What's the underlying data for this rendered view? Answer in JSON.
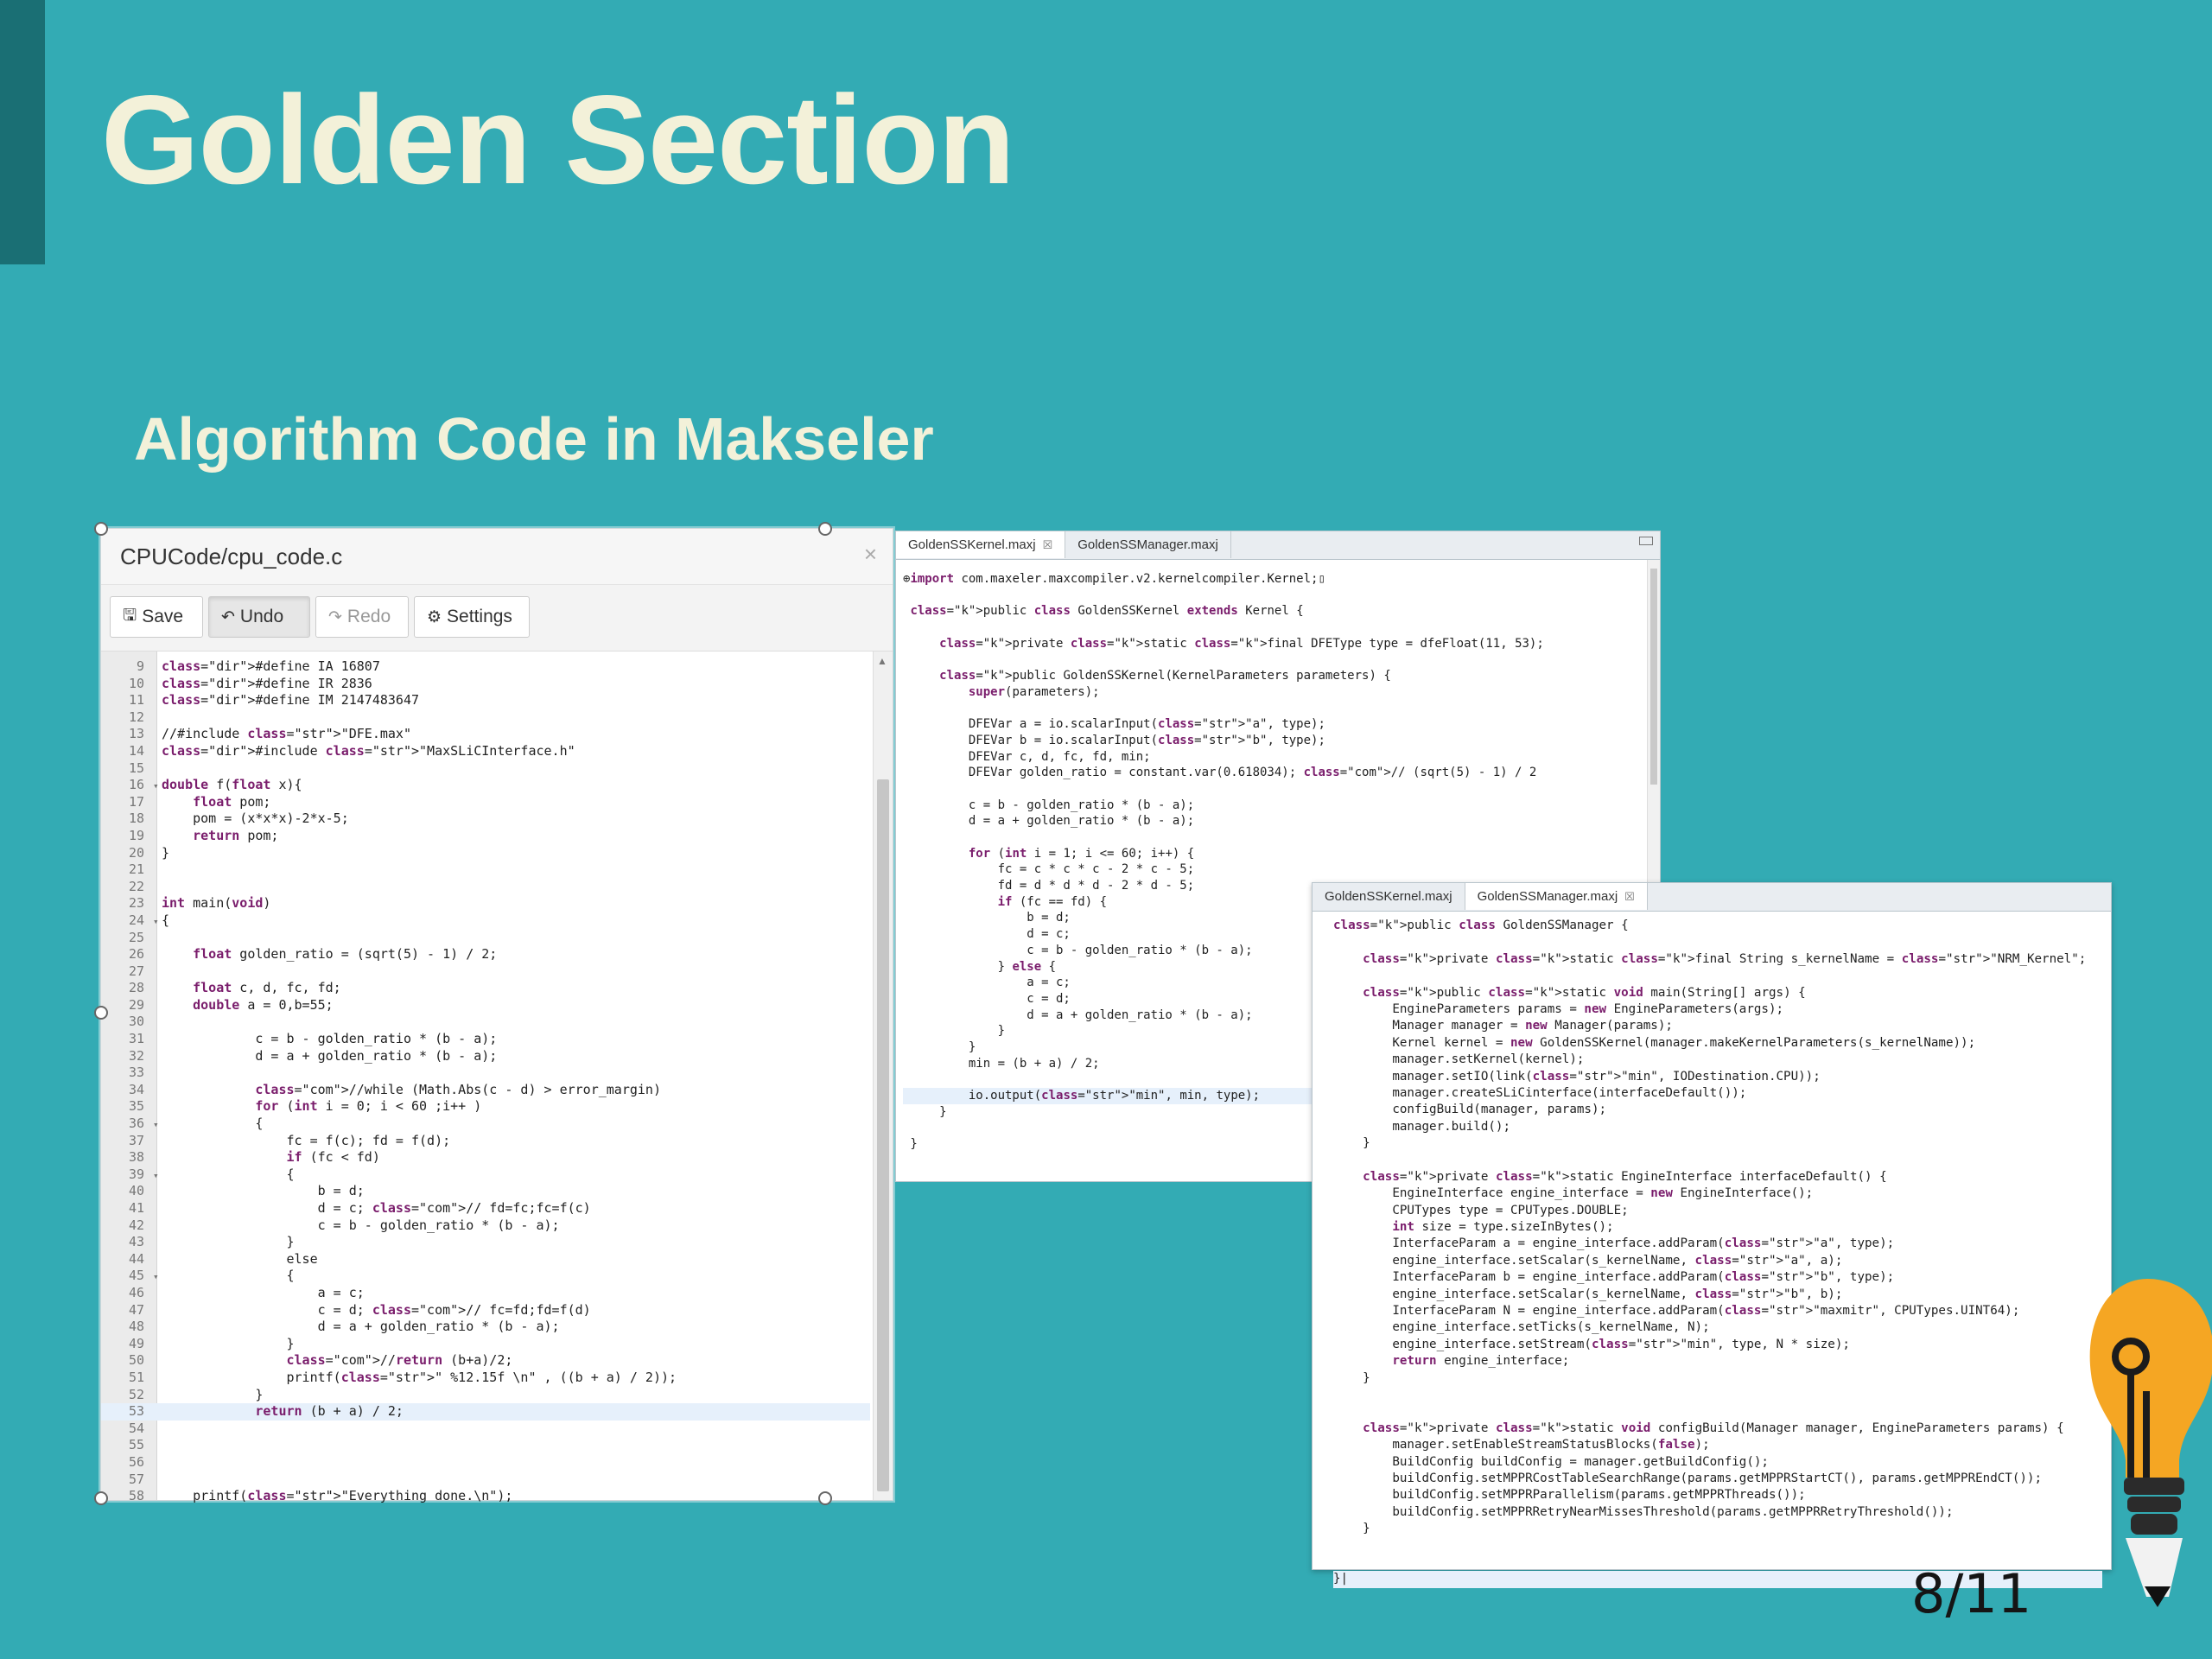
{
  "slide": {
    "title": "Golden Section",
    "subtitle": "Algorithm Code in Makseler",
    "page_number": "8/11"
  },
  "c_editor": {
    "title": "CPUCode/cpu_code.c",
    "close": "×",
    "toolbar": {
      "save": "Save",
      "undo": "Undo",
      "redo": "Redo",
      "settings": "Settings"
    },
    "lines": [
      {
        "n": "9",
        "t": "#define IA 16807"
      },
      {
        "n": "10",
        "t": "#define IR 2836"
      },
      {
        "n": "11",
        "t": "#define IM 2147483647"
      },
      {
        "n": "12",
        "t": ""
      },
      {
        "n": "13",
        "t": "//#include \"DFE.max\""
      },
      {
        "n": "14",
        "t": "#include \"MaxSLiCInterface.h\""
      },
      {
        "n": "15",
        "t": ""
      },
      {
        "n": "16",
        "t": "double f(float x){",
        "fold": "▾"
      },
      {
        "n": "17",
        "t": "    float pom;"
      },
      {
        "n": "18",
        "t": "    pom = (x*x*x)-2*x-5;"
      },
      {
        "n": "19",
        "t": "    return pom;"
      },
      {
        "n": "20",
        "t": "}"
      },
      {
        "n": "21",
        "t": ""
      },
      {
        "n": "22",
        "t": ""
      },
      {
        "n": "23",
        "t": "int main(void)"
      },
      {
        "n": "24",
        "t": "{",
        "fold": "▾"
      },
      {
        "n": "25",
        "t": ""
      },
      {
        "n": "26",
        "t": "    float golden_ratio = (sqrt(5) - 1) / 2;"
      },
      {
        "n": "27",
        "t": ""
      },
      {
        "n": "28",
        "t": "    float c, d, fc, fd;"
      },
      {
        "n": "29",
        "t": "    double a = 0,b=55;"
      },
      {
        "n": "30",
        "t": ""
      },
      {
        "n": "31",
        "t": "            c = b - golden_ratio * (b - a);"
      },
      {
        "n": "32",
        "t": "            d = a + golden_ratio * (b - a);"
      },
      {
        "n": "33",
        "t": ""
      },
      {
        "n": "34",
        "t": "            //while (Math.Abs(c - d) > error_margin)"
      },
      {
        "n": "35",
        "t": "            for (int i = 0; i < 60 ;i++ )"
      },
      {
        "n": "36",
        "t": "            {",
        "fold": "▾"
      },
      {
        "n": "37",
        "t": "                fc = f(c); fd = f(d);"
      },
      {
        "n": "38",
        "t": "                if (fc < fd)"
      },
      {
        "n": "39",
        "t": "                {",
        "fold": "▾"
      },
      {
        "n": "40",
        "t": "                    b = d;"
      },
      {
        "n": "41",
        "t": "                    d = c; // fd=fc;fc=f(c)"
      },
      {
        "n": "42",
        "t": "                    c = b - golden_ratio * (b - a);"
      },
      {
        "n": "43",
        "t": "                }"
      },
      {
        "n": "44",
        "t": "                else"
      },
      {
        "n": "45",
        "t": "                {",
        "fold": "▾"
      },
      {
        "n": "46",
        "t": "                    a = c;"
      },
      {
        "n": "47",
        "t": "                    c = d; // fc=fd;fd=f(d)"
      },
      {
        "n": "48",
        "t": "                    d = a + golden_ratio * (b - a);"
      },
      {
        "n": "49",
        "t": "                }"
      },
      {
        "n": "50",
        "t": "                //return (b+a)/2;"
      },
      {
        "n": "51",
        "t": "                printf(\" %12.15f \\n\" , ((b + a) / 2));"
      },
      {
        "n": "52",
        "t": "            }"
      },
      {
        "n": "53",
        "t": "            return (b + a) / 2;",
        "hl": true
      },
      {
        "n": "54",
        "t": ""
      },
      {
        "n": "55",
        "t": ""
      },
      {
        "n": "56",
        "t": ""
      },
      {
        "n": "57",
        "t": ""
      },
      {
        "n": "58",
        "t": "    printf(\"Everything done.\\n\");"
      }
    ]
  },
  "kernel_editor": {
    "tabs": [
      "GoldenSSKernel.maxj",
      "GoldenSSManager.maxj"
    ],
    "tab_close": "☒",
    "lines": [
      {
        "t": "⊕import com.maxeler.maxcompiler.v2.kernelcompiler.Kernel;▯"
      },
      {
        "t": ""
      },
      {
        "t": " public class GoldenSSKernel extends Kernel {"
      },
      {
        "t": ""
      },
      {
        "t": "     private static final DFEType type = dfeFloat(11, 53);"
      },
      {
        "t": ""
      },
      {
        "t": "     public GoldenSSKernel(KernelParameters parameters) {"
      },
      {
        "t": "         super(parameters);"
      },
      {
        "t": ""
      },
      {
        "t": "         DFEVar a = io.scalarInput(\"a\", type);"
      },
      {
        "t": "         DFEVar b = io.scalarInput(\"b\", type);"
      },
      {
        "t": "         DFEVar c, d, fc, fd, min;"
      },
      {
        "t": "         DFEVar golden_ratio = constant.var(0.618034); // (sqrt(5) - 1) / 2"
      },
      {
        "t": ""
      },
      {
        "t": "         c = b - golden_ratio * (b - a);"
      },
      {
        "t": "         d = a + golden_ratio * (b - a);"
      },
      {
        "t": ""
      },
      {
        "t": "         for (int i = 1; i <= 60; i++) {"
      },
      {
        "t": "             fc = c * c * c - 2 * c - 5;"
      },
      {
        "t": "             fd = d * d * d - 2 * d - 5;"
      },
      {
        "t": "             if (fc == fd) {"
      },
      {
        "t": "                 b = d;"
      },
      {
        "t": "                 d = c;"
      },
      {
        "t": "                 c = b - golden_ratio * (b - a);"
      },
      {
        "t": "             } else {"
      },
      {
        "t": "                 a = c;"
      },
      {
        "t": "                 c = d;"
      },
      {
        "t": "                 d = a + golden_ratio * (b - a);"
      },
      {
        "t": "             }"
      },
      {
        "t": "         }"
      },
      {
        "t": "         min = (b + a) / 2;"
      },
      {
        "t": ""
      },
      {
        "t": "         io.output(\"min\", min, type);",
        "hl": true
      },
      {
        "t": "     }"
      },
      {
        "t": ""
      },
      {
        "t": " }"
      }
    ]
  },
  "manager_editor": {
    "tabs": [
      "GoldenSSKernel.maxj",
      "GoldenSSManager.maxj"
    ],
    "tab_close": "☒",
    "lines": [
      {
        "t": "public class GoldenSSManager {"
      },
      {
        "t": ""
      },
      {
        "t": "    private static final String s_kernelName = \"NRM_Kernel\";"
      },
      {
        "t": ""
      },
      {
        "t": "    public static void main(String[] args) {"
      },
      {
        "t": "        EngineParameters params = new EngineParameters(args);"
      },
      {
        "t": "        Manager manager = new Manager(params);"
      },
      {
        "t": "        Kernel kernel = new GoldenSSKernel(manager.makeKernelParameters(s_kernelName));"
      },
      {
        "t": "        manager.setKernel(kernel);"
      },
      {
        "t": "        manager.setIO(link(\"min\", IODestination.CPU));"
      },
      {
        "t": "        manager.createSLiCinterface(interfaceDefault());"
      },
      {
        "t": "        configBuild(manager, params);"
      },
      {
        "t": "        manager.build();"
      },
      {
        "t": "    }"
      },
      {
        "t": ""
      },
      {
        "t": "    private static EngineInterface interfaceDefault() {"
      },
      {
        "t": "        EngineInterface engine_interface = new EngineInterface();"
      },
      {
        "t": "        CPUTypes type = CPUTypes.DOUBLE;"
      },
      {
        "t": "        int size = type.sizeInBytes();"
      },
      {
        "t": "        InterfaceParam a = engine_interface.addParam(\"a\", type);"
      },
      {
        "t": "        engine_interface.setScalar(s_kernelName, \"a\", a);"
      },
      {
        "t": "        InterfaceParam b = engine_interface.addParam(\"b\", type);"
      },
      {
        "t": "        engine_interface.setScalar(s_kernelName, \"b\", b);"
      },
      {
        "t": "        InterfaceParam N = engine_interface.addParam(\"maxmitr\", CPUTypes.UINT64);"
      },
      {
        "t": "        engine_interface.setTicks(s_kernelName, N);"
      },
      {
        "t": "        engine_interface.setStream(\"min\", type, N * size);"
      },
      {
        "t": "        return engine_interface;"
      },
      {
        "t": "    }"
      },
      {
        "t": ""
      },
      {
        "t": ""
      },
      {
        "t": "    private static void configBuild(Manager manager, EngineParameters params) {"
      },
      {
        "t": "        manager.setEnableStreamStatusBlocks(false);"
      },
      {
        "t": "        BuildConfig buildConfig = manager.getBuildConfig();"
      },
      {
        "t": "        buildConfig.setMPPRCostTableSearchRange(params.getMPPRStartCT(), params.getMPPREndCT());"
      },
      {
        "t": "        buildConfig.setMPPRParallelism(params.getMPPRThreads());"
      },
      {
        "t": "        buildConfig.setMPPRRetryNearMissesThreshold(params.getMPPRRetryThreshold());"
      },
      {
        "t": "    }"
      },
      {
        "t": ""
      },
      {
        "t": ""
      },
      {
        "t": "}|",
        "hl": true
      }
    ]
  },
  "colors": {
    "background": "#33abb4",
    "accent_bar": "#1a6f74",
    "title": "#f3f1d9",
    "bulb": "#f5a623"
  },
  "icons": {
    "save": "floppy-disk-icon",
    "undo": "undo-arrow-icon",
    "redo": "redo-arrow-icon",
    "settings": "gear-icon",
    "decoration": "light-bulb-icon"
  }
}
